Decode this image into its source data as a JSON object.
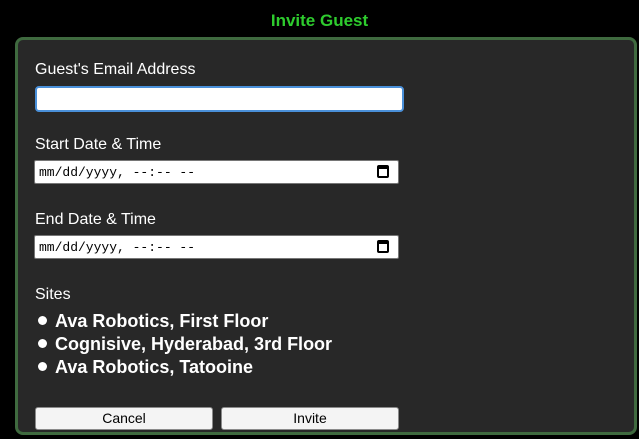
{
  "dialog": {
    "title": "Invite Guest"
  },
  "form": {
    "email_label": "Guest's Email Address",
    "email_value": "",
    "start_label": "Start Date & Time",
    "start_placeholder": "mm/dd/yyyy, --:-- --",
    "end_label": "End Date & Time",
    "end_placeholder": "mm/dd/yyyy, --:-- --",
    "sites_label": "Sites",
    "sites": [
      "Ava Robotics, First Floor",
      "Cognisive, Hyderabad, 3rd Floor",
      "Ava Robotics, Tatooine"
    ]
  },
  "buttons": {
    "cancel": "Cancel",
    "invite": "Invite"
  },
  "colors": {
    "title": "#2ecc2e",
    "dialog_border": "#3f6a3f",
    "dialog_bg": "#282828",
    "focus_ring": "#4a90d9"
  },
  "icons": {
    "date_picker": "calendar-icon",
    "list_marker": "bullet-icon"
  }
}
